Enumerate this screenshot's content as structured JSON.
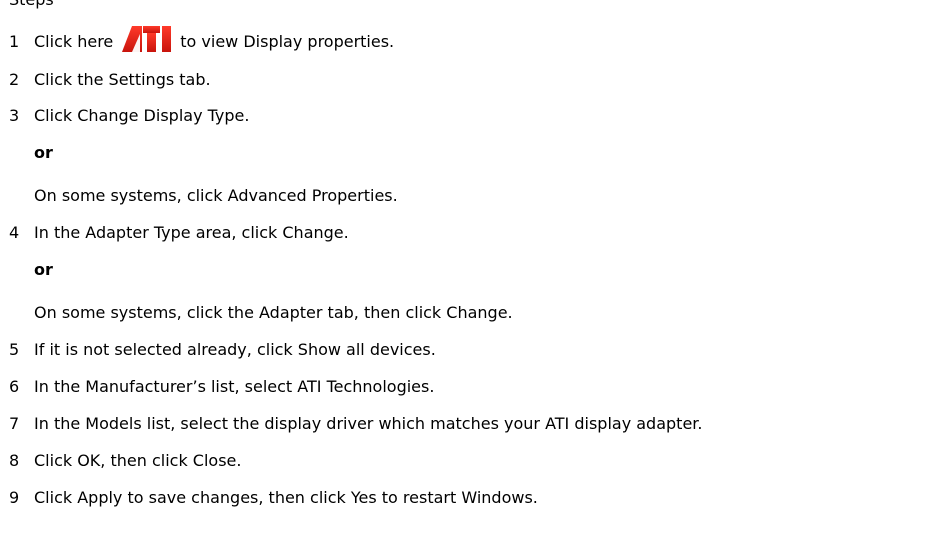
{
  "header": {
    "clipped_text": "Steps"
  },
  "logo": {
    "text": "ATI",
    "icon": "ati-logo-icon",
    "color": "#e8261b"
  },
  "steps": [
    {
      "num": "1",
      "before": "Click here",
      "after": "to view Display properties."
    },
    {
      "num": "2",
      "text": "Click the Settings tab."
    },
    {
      "num": "3",
      "text": "Click Change Display Type."
    },
    {
      "or": "or",
      "alt": "On some systems, click Advanced Properties."
    },
    {
      "num": "4",
      "text": "In the Adapter Type area, click Change."
    },
    {
      "or": "or",
      "alt": "On some systems, click the Adapter tab, then click Change."
    },
    {
      "num": "5",
      "text": "If it is not selected already, click Show all devices."
    },
    {
      "num": "6",
      "text": "In the Manufacturer’s list, select ATI Technologies."
    },
    {
      "num": "7",
      "text": "In the Models list, select the display driver which matches your ATI display adapter."
    },
    {
      "num": "8",
      "text": "Click OK, then click Close."
    },
    {
      "num": "9",
      "text": "Click Apply to save changes, then click Yes to restart Windows."
    }
  ]
}
